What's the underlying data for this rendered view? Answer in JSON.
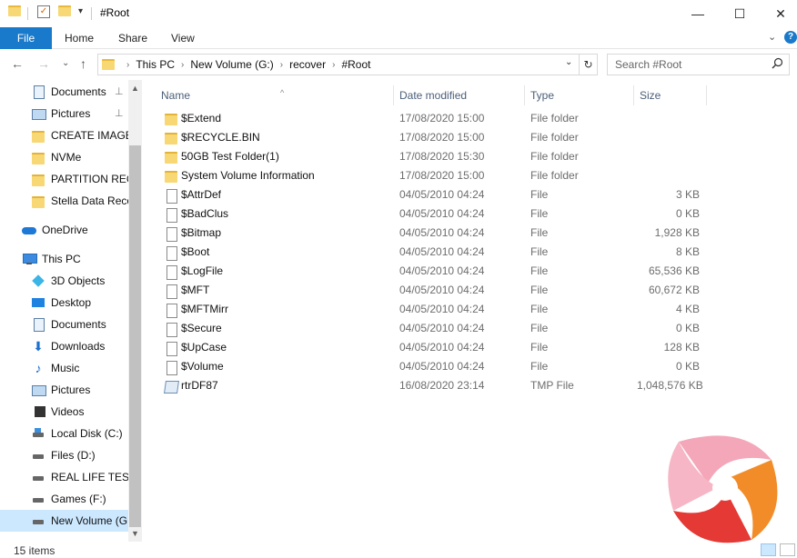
{
  "window": {
    "title": "#Root",
    "minimize_glyph": "—",
    "maximize_glyph": "☐",
    "close_glyph": "✕"
  },
  "ribbon": {
    "tabs": [
      "File",
      "Home",
      "Share",
      "View"
    ],
    "expand_glyph": "⌄",
    "help_glyph": "?"
  },
  "address": {
    "back_glyph": "←",
    "forward_glyph": "→",
    "recent_glyph": "⌄",
    "up_glyph": "↑",
    "crumbs": [
      "This PC",
      "New Volume (G:)",
      "recover",
      "#Root"
    ],
    "separator": "›",
    "dropdown_glyph": "⌄",
    "refresh_glyph": "↻",
    "search_placeholder": "Search #Root",
    "search_icon": "search-icon"
  },
  "sidebar": {
    "quick_access": [
      {
        "label": "Documents",
        "icon": "documents-icon",
        "pinned": true
      },
      {
        "label": "Pictures",
        "icon": "pictures-icon",
        "pinned": true
      },
      {
        "label": "CREATE IMAGE",
        "icon": "folder-icon"
      },
      {
        "label": "NVMe",
        "icon": "folder-icon"
      },
      {
        "label": "PARTITION RECO",
        "icon": "folder-icon"
      },
      {
        "label": "Stella Data Reco",
        "icon": "folder-icon"
      }
    ],
    "onedrive": "OneDrive",
    "this_pc": "This PC",
    "this_pc_items": [
      {
        "label": "3D Objects",
        "icon": "3d-objects-icon"
      },
      {
        "label": "Desktop",
        "icon": "desktop-icon"
      },
      {
        "label": "Documents",
        "icon": "documents-icon"
      },
      {
        "label": "Downloads",
        "icon": "downloads-icon"
      },
      {
        "label": "Music",
        "icon": "music-icon"
      },
      {
        "label": "Pictures",
        "icon": "pictures-icon"
      },
      {
        "label": "Videos",
        "icon": "videos-icon"
      },
      {
        "label": "Local Disk (C:)",
        "icon": "local-disk-icon"
      },
      {
        "label": "Files (D:)",
        "icon": "drive-icon"
      },
      {
        "label": "REAL LIFE TEST F",
        "icon": "drive-icon"
      },
      {
        "label": "Games (F:)",
        "icon": "drive-icon"
      },
      {
        "label": "New Volume (G:)",
        "icon": "drive-icon",
        "selected": true
      }
    ],
    "pin_glyph": "📌",
    "scroll_up_glyph": "▲",
    "scroll_down_glyph": "▼"
  },
  "columns": {
    "name": "Name",
    "date": "Date modified",
    "type": "Type",
    "size": "Size",
    "sort_glyph": "^"
  },
  "files": [
    {
      "name": "$Extend",
      "date": "17/08/2020 15:00",
      "type": "File folder",
      "size": "",
      "kind": "folder"
    },
    {
      "name": "$RECYCLE.BIN",
      "date": "17/08/2020 15:00",
      "type": "File folder",
      "size": "",
      "kind": "folder"
    },
    {
      "name": "50GB Test Folder(1)",
      "date": "17/08/2020 15:30",
      "type": "File folder",
      "size": "",
      "kind": "folder"
    },
    {
      "name": "System Volume Information",
      "date": "17/08/2020 15:00",
      "type": "File folder",
      "size": "",
      "kind": "folder"
    },
    {
      "name": "$AttrDef",
      "date": "04/05/2010 04:24",
      "type": "File",
      "size": "3 KB",
      "kind": "file"
    },
    {
      "name": "$BadClus",
      "date": "04/05/2010 04:24",
      "type": "File",
      "size": "0 KB",
      "kind": "file"
    },
    {
      "name": "$Bitmap",
      "date": "04/05/2010 04:24",
      "type": "File",
      "size": "1,928 KB",
      "kind": "file"
    },
    {
      "name": "$Boot",
      "date": "04/05/2010 04:24",
      "type": "File",
      "size": "8 KB",
      "kind": "file"
    },
    {
      "name": "$LogFile",
      "date": "04/05/2010 04:24",
      "type": "File",
      "size": "65,536 KB",
      "kind": "file"
    },
    {
      "name": "$MFT",
      "date": "04/05/2010 04:24",
      "type": "File",
      "size": "60,672 KB",
      "kind": "file"
    },
    {
      "name": "$MFTMirr",
      "date": "04/05/2010 04:24",
      "type": "File",
      "size": "4 KB",
      "kind": "file"
    },
    {
      "name": "$Secure",
      "date": "04/05/2010 04:24",
      "type": "File",
      "size": "0 KB",
      "kind": "file"
    },
    {
      "name": "$UpCase",
      "date": "04/05/2010 04:24",
      "type": "File",
      "size": "128 KB",
      "kind": "file"
    },
    {
      "name": "$Volume",
      "date": "04/05/2010 04:24",
      "type": "File",
      "size": "0 KB",
      "kind": "file"
    },
    {
      "name": "rtrDF87",
      "date": "16/08/2020 23:14",
      "type": "TMP File",
      "size": "1,048,576 KB",
      "kind": "tmp"
    }
  ],
  "status": {
    "items_count": "15 items"
  },
  "colors": {
    "accent": "#1979ca",
    "selection": "#cce8ff",
    "logo_pink": "#f4a7b9",
    "logo_orange": "#f28c28",
    "logo_red": "#e53935"
  }
}
